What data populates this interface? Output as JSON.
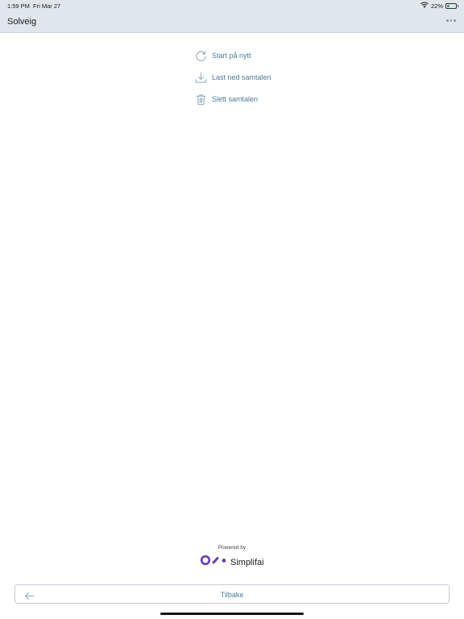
{
  "status_bar": {
    "time": "1:59 PM",
    "date": "Fri Mar 27",
    "battery_text": "22%",
    "icons": [
      "wifi-icon",
      "battery-icon"
    ]
  },
  "header": {
    "title": "Solveig",
    "more_icon": "ellipsis-icon"
  },
  "menu": {
    "items": [
      {
        "label": "Start på nytt",
        "icon": "restart-icon"
      },
      {
        "label": "Last ned samtalen",
        "icon": "download-icon"
      },
      {
        "label": "Slett samtalen",
        "icon": "trash-icon"
      }
    ]
  },
  "footer": {
    "powered_by": "Powered by",
    "brand_name": "Simplifai",
    "brand_icon": "simplifai-logo-icon"
  },
  "back_button": {
    "label": "Tilbake",
    "icon": "arrow-left-icon"
  },
  "colors": {
    "header_bg": "#dfe6ec",
    "accent_text": "#4f7b98",
    "icon_stroke": "#8fa9bb",
    "brand_purple": "#6c3fb0",
    "battery_green": "#2fb44a"
  }
}
